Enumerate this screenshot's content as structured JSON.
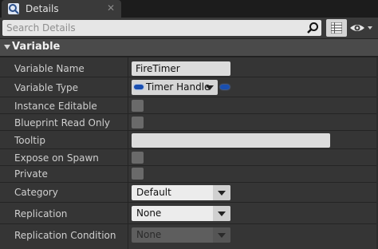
{
  "tab": {
    "title": "Details",
    "close_glyph": "✕",
    "icon": "details-magnifier-icon"
  },
  "search": {
    "placeholder": "Search Details",
    "icon": "search-icon"
  },
  "toolbar": {
    "property_matrix_icon": "grid-icon",
    "view_options_icon": "eye-icon"
  },
  "category": {
    "label": "Variable",
    "expanded": true
  },
  "properties": {
    "variable_name": {
      "label": "Variable Name",
      "value": "FireTimer"
    },
    "variable_type": {
      "label": "Variable Type",
      "value": "Timer Handle",
      "pin_color": "#1a4fb0"
    },
    "instance_editable": {
      "label": "Instance Editable",
      "checked": false
    },
    "blueprint_read_only": {
      "label": "Blueprint Read Only",
      "checked": false
    },
    "tooltip": {
      "label": "Tooltip",
      "value": ""
    },
    "expose_on_spawn": {
      "label": "Expose on Spawn",
      "checked": false
    },
    "private": {
      "label": "Private",
      "checked": false
    },
    "category": {
      "label": "Category",
      "value": "Default"
    },
    "replication": {
      "label": "Replication",
      "value": "None"
    },
    "replication_condition": {
      "label": "Replication Condition",
      "value": "None",
      "disabled": true
    }
  }
}
